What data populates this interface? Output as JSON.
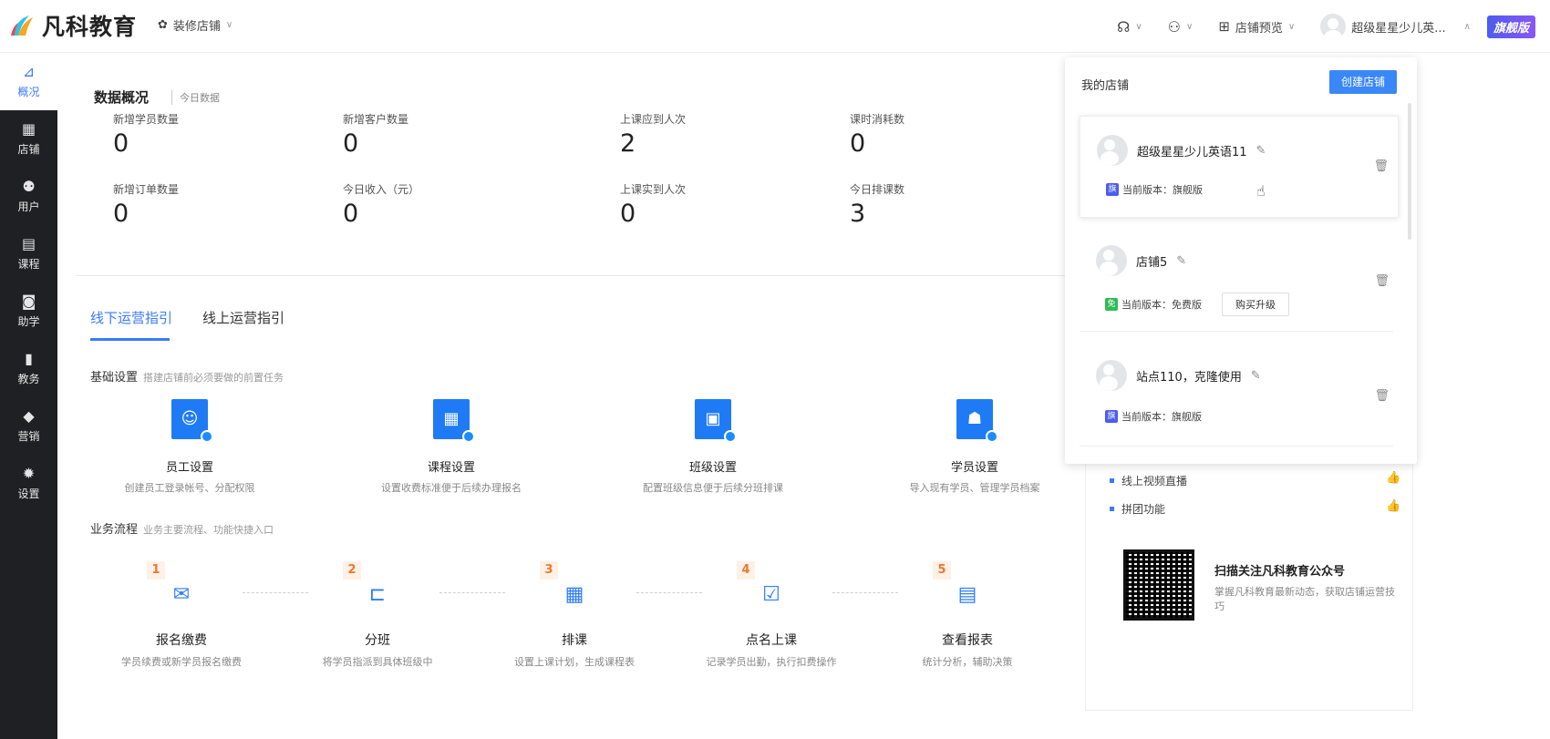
{
  "topbar": {
    "logo_text": "凡科教育",
    "decor_label": "装修店铺",
    "store_preview_label": "店铺预览",
    "username": "超级星星少儿英...",
    "flag_badge": "旗舰版"
  },
  "sidebar": {
    "items": [
      {
        "label": "概况",
        "icon": "chart-icon"
      },
      {
        "label": "店铺",
        "icon": "store-icon"
      },
      {
        "label": "用户",
        "icon": "users-icon"
      },
      {
        "label": "课程",
        "icon": "doc-icon"
      },
      {
        "label": "助学",
        "icon": "gamepad-icon"
      },
      {
        "label": "教务",
        "icon": "book-icon"
      },
      {
        "label": "营销",
        "icon": "tag-icon"
      },
      {
        "label": "设置",
        "icon": "gear-icon"
      }
    ]
  },
  "overview": {
    "title": "数据概况",
    "subtitle": "今日数据",
    "stats": [
      {
        "label": "新增学员数量",
        "value": "0"
      },
      {
        "label": "新增客户数量",
        "value": "0"
      },
      {
        "label": "上课应到人次",
        "value": "2"
      },
      {
        "label": "课时消耗数",
        "value": "0"
      },
      {
        "label": "新增订单数量",
        "value": "0"
      },
      {
        "label": "今日收入（元）",
        "value": "0"
      },
      {
        "label": "上课实到人次",
        "value": "0"
      },
      {
        "label": "今日排课数",
        "value": "3"
      }
    ]
  },
  "tabs": {
    "offline": "线下运营指引",
    "online": "线上运营指引"
  },
  "basic": {
    "title": "基础设置",
    "subtitle": "搭建店铺前必须要做的前置任务",
    "items": [
      {
        "name": "员工设置",
        "desc": "创建员工登录帐号、分配权限"
      },
      {
        "name": "课程设置",
        "desc": "设置收费标准便于后续办理报名"
      },
      {
        "name": "班级设置",
        "desc": "配置班级信息便于后续分班排课"
      },
      {
        "name": "学员设置",
        "desc": "导入现有学员、管理学员档案"
      }
    ]
  },
  "flow": {
    "title": "业务流程",
    "subtitle": "业务主要流程、功能快捷入口",
    "items": [
      {
        "num": "1",
        "name": "报名缴费",
        "desc": "学员续费或新学员报名缴费"
      },
      {
        "num": "2",
        "name": "分班",
        "desc": "将学员指派到具体班级中"
      },
      {
        "num": "3",
        "name": "排课",
        "desc": "设置上课计划，生成课程表"
      },
      {
        "num": "4",
        "name": "点名上课",
        "desc": "记录学员出勤，执行扣费操作"
      },
      {
        "num": "5",
        "name": "查看报表",
        "desc": "统计分析，辅助决策"
      }
    ]
  },
  "right_panel": {
    "bullets": [
      "线上视频直播",
      "拼团功能"
    ],
    "qr_title": "扫描关注凡科教育公众号",
    "qr_desc": "掌握凡科教育最新动态，获取店铺运营技巧"
  },
  "dropdown": {
    "title": "我的店铺",
    "create_label": "创建店铺",
    "stores": [
      {
        "name": "超级星星少儿英语11",
        "version": "当前版本：旗舰版",
        "flag": "旗",
        "flag_color": "#4b5cf0"
      },
      {
        "name": "店铺5",
        "version": "当前版本：免费版",
        "flag": "免",
        "flag_color": "#2dbb55",
        "upgrade": "购买升级"
      },
      {
        "name": "站点110，克隆使用",
        "version": "当前版本：旗舰版",
        "flag": "旗",
        "flag_color": "#4b5cf0"
      }
    ]
  },
  "colors": {
    "accent": "#3a7afe",
    "sidebar_bg": "#1f2024",
    "flow_num": "#f0782f"
  }
}
